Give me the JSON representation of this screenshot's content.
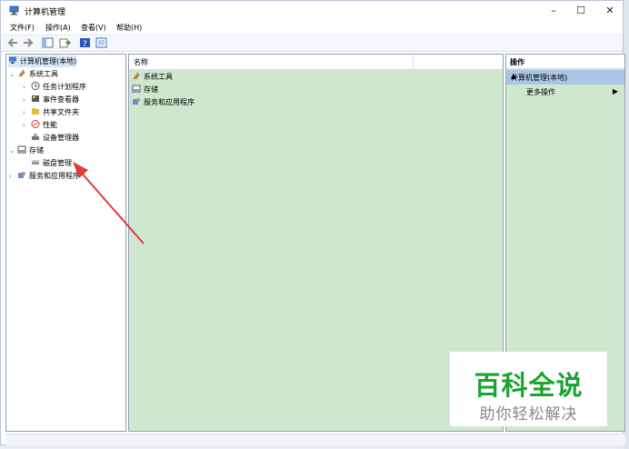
{
  "window": {
    "title": "计算机管理",
    "min_glyph": "–",
    "max_glyph": "☐",
    "close_glyph": "✕"
  },
  "menu": [
    "文件(F)",
    "操作(A)",
    "查看(V)",
    "帮助(H)"
  ],
  "tree": {
    "root": "计算机管理(本地)",
    "system_tools": "系统工具",
    "task_scheduler": "任务计划程序",
    "event_viewer": "事件查看器",
    "shared_folders": "共享文件夹",
    "performance": "性能",
    "device_manager": "设备管理器",
    "storage": "存储",
    "disk_management": "磁盘管理",
    "services_apps": "服务和应用程序"
  },
  "list": {
    "header_name": "名称",
    "items": [
      "系统工具",
      "存储",
      "服务和应用程序"
    ]
  },
  "actions": {
    "title": "操作",
    "selected": "计算机管理(本地)",
    "more": "更多操作"
  },
  "watermark": {
    "brand": "百科全说",
    "slogan": "助你轻松解决"
  },
  "colors": {
    "pane_green": "#cfe7cf",
    "selection_blue": "#a9c6e6",
    "arrow_red": "#e23b3b",
    "brand_green": "#1aa530"
  }
}
